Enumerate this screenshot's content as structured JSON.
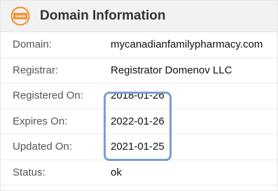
{
  "header": {
    "icon": "www-globe-icon",
    "icon_text": "www",
    "title": "Domain Information",
    "accent_color": "#f08c2a"
  },
  "rows": [
    {
      "label": "Domain:",
      "value": "mycanadianfamilypharmacy.com"
    },
    {
      "label": "Registrar:",
      "value": "Registrator Domenov LLC"
    },
    {
      "label": "Registered On:",
      "value": "2018-01-26"
    },
    {
      "label": "Expires On:",
      "value": "2022-01-26"
    },
    {
      "label": "Updated On:",
      "value": "2021-01-25"
    },
    {
      "label": "Status:",
      "value": "ok"
    }
  ],
  "highlight_color": "#7a9fd1"
}
